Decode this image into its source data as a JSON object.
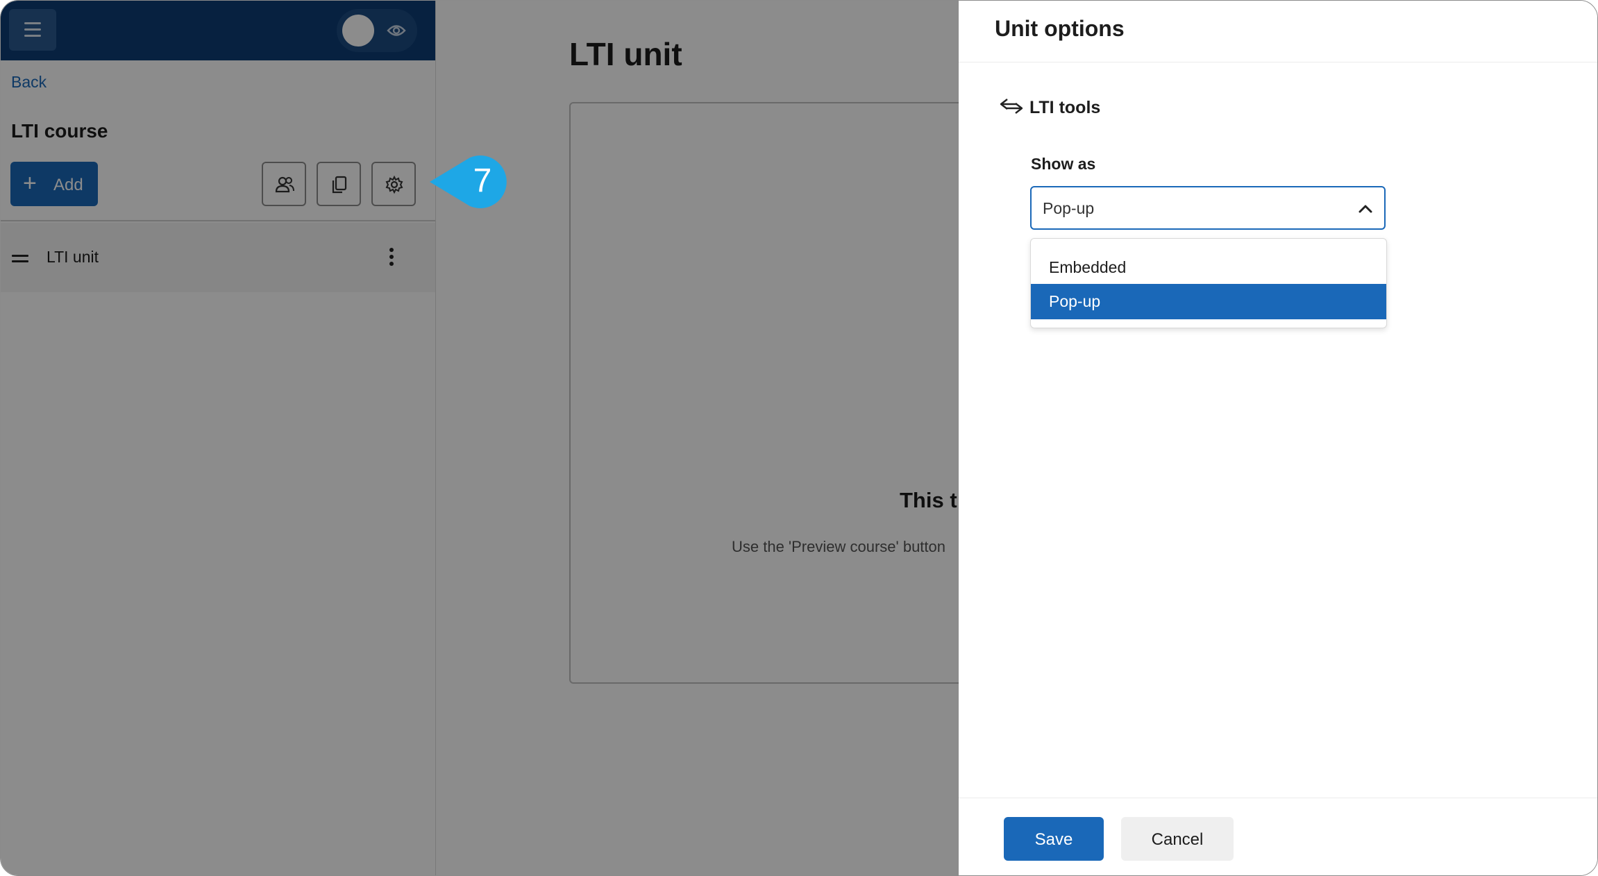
{
  "sidebar": {
    "back_label": "Back",
    "course_title": "LTI course",
    "add_label": "Add",
    "units": [
      {
        "label": "LTI unit"
      }
    ]
  },
  "main": {
    "title": "LTI unit",
    "heading": "This t",
    "description": "Use the 'Preview course' button"
  },
  "callout": {
    "number": "7"
  },
  "panel": {
    "title": "Unit options",
    "section_title": "LTI tools",
    "show_as_label": "Show as",
    "selected_value": "Pop-up",
    "options": [
      {
        "label": "Embedded"
      },
      {
        "label": "Pop-up"
      }
    ],
    "save_label": "Save",
    "cancel_label": "Cancel"
  },
  "colors": {
    "brand": "#1a68b8",
    "topbar": "#0d3d75",
    "callout": "#1ea7e6"
  },
  "icons": [
    "menu-icon",
    "eye-icon",
    "plus-icon",
    "users-icon",
    "copy-icon",
    "gear-icon",
    "drag-handle-icon",
    "more-vertical-icon",
    "link-icon",
    "chevron-up-icon"
  ]
}
